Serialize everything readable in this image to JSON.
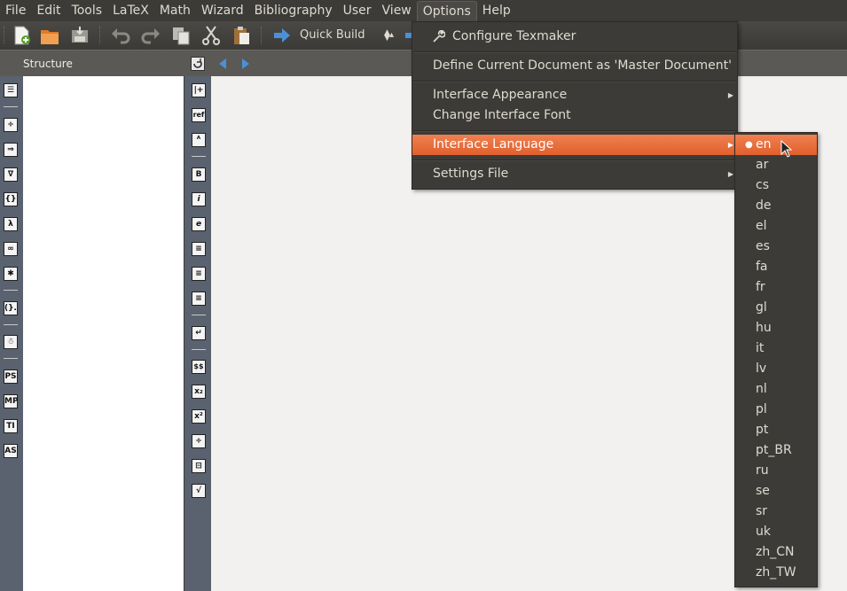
{
  "menubar": {
    "items": [
      "File",
      "Edit",
      "Tools",
      "LaTeX",
      "Math",
      "Wizard",
      "Bibliography",
      "User",
      "View",
      "Options",
      "Help"
    ],
    "open_item": "Options"
  },
  "toolbar": {
    "build_select": "Quick Build"
  },
  "structure": {
    "title": "Structure"
  },
  "left_icons": [
    "label-list",
    "divide",
    "implies",
    "nabla",
    "braces",
    "lambda",
    "infinity",
    "asterisk",
    "paren-dot",
    "stick-figure",
    "PS",
    "MP",
    "TI",
    "AS"
  ],
  "mid_icons": [
    "ref-plus",
    "ref",
    "font-size",
    "B",
    "i",
    "e",
    "align-left",
    "align-center",
    "align-right",
    "return",
    "$$",
    "sub",
    "sup",
    "frac",
    "dfrac",
    "sqrt"
  ],
  "mid_icon_labels": {
    "ref": "ref",
    "bold": "B",
    "italic": "i",
    "emph": "e",
    "dollar": "$$"
  },
  "left_icon_labels": {
    "ps": "PS",
    "mp": "MP",
    "ti": "TI",
    "as": "AS"
  },
  "options_menu": {
    "configure": "Configure Texmaker",
    "master": "Define Current Document as 'Master Document'",
    "appearance": "Interface Appearance",
    "font": "Change Interface Font",
    "language": "Interface Language",
    "settings": "Settings File"
  },
  "languages": [
    "en",
    "ar",
    "cs",
    "de",
    "el",
    "es",
    "fa",
    "fr",
    "gl",
    "hu",
    "it",
    "lv",
    "nl",
    "pl",
    "pt",
    "pt_BR",
    "ru",
    "se",
    "sr",
    "uk",
    "zh_CN",
    "zh_TW"
  ],
  "selected_language": "en",
  "colors": {
    "highlight": "#e9683a",
    "menu_bg": "#3c3b37",
    "panel_blue": "#59626e"
  }
}
